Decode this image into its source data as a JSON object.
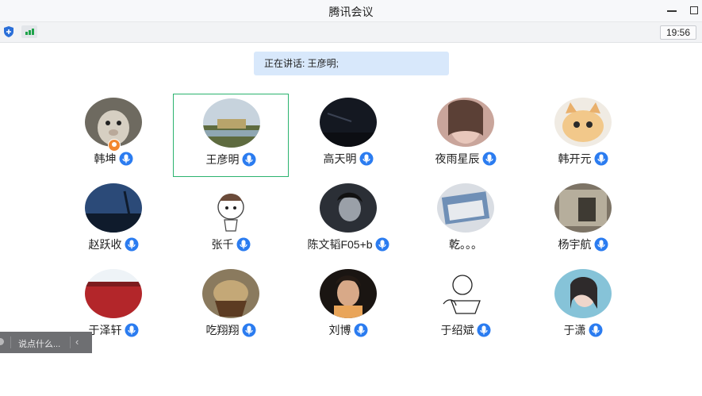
{
  "window": {
    "title": "腾讯会议"
  },
  "statusbar": {
    "time": "19:56",
    "shield_icon": "shield-icon",
    "signal_icon": "signal-icon"
  },
  "speaking": {
    "text": "正在讲话: 王彦明;"
  },
  "participants": [
    {
      "name": "韩坤",
      "mic": "mic-icon",
      "host": true,
      "active": false
    },
    {
      "name": "王彦明",
      "mic": "mic-icon",
      "host": false,
      "active": true
    },
    {
      "name": "高天明",
      "mic": "mic-icon",
      "host": false,
      "active": false
    },
    {
      "name": "夜雨星辰",
      "mic": "mic-icon",
      "host": false,
      "active": false
    },
    {
      "name": "韩开元",
      "mic": "mic-icon",
      "host": false,
      "active": false
    },
    {
      "name": "赵跃收",
      "mic": "mic-icon",
      "host": false,
      "active": false
    },
    {
      "name": "张千",
      "mic": "mic-icon",
      "host": false,
      "active": false
    },
    {
      "name": "陈文韬F05+b",
      "mic": "mic-icon",
      "host": false,
      "active": false
    },
    {
      "name": "乾。。。",
      "mic": "",
      "host": false,
      "active": false
    },
    {
      "name": "杨宇航",
      "mic": "mic-icon",
      "host": false,
      "active": false
    },
    {
      "name": "于泽轩",
      "mic": "mic-icon",
      "host": false,
      "active": false
    },
    {
      "name": "吃翔翔",
      "mic": "mic-icon",
      "host": false,
      "active": false
    },
    {
      "name": "刘博",
      "mic": "mic-icon",
      "host": false,
      "active": false
    },
    {
      "name": "于绍斌",
      "mic": "mic-icon",
      "host": false,
      "active": false
    },
    {
      "name": "于潇",
      "mic": "mic-icon",
      "host": false,
      "active": false
    }
  ],
  "chat": {
    "placeholder": "说点什么..."
  },
  "colors": {
    "accent": "#2b7cf0",
    "active_border": "#2bb36f",
    "speaking_bg": "#d8e8fb",
    "host_badge": "#f2872f"
  }
}
